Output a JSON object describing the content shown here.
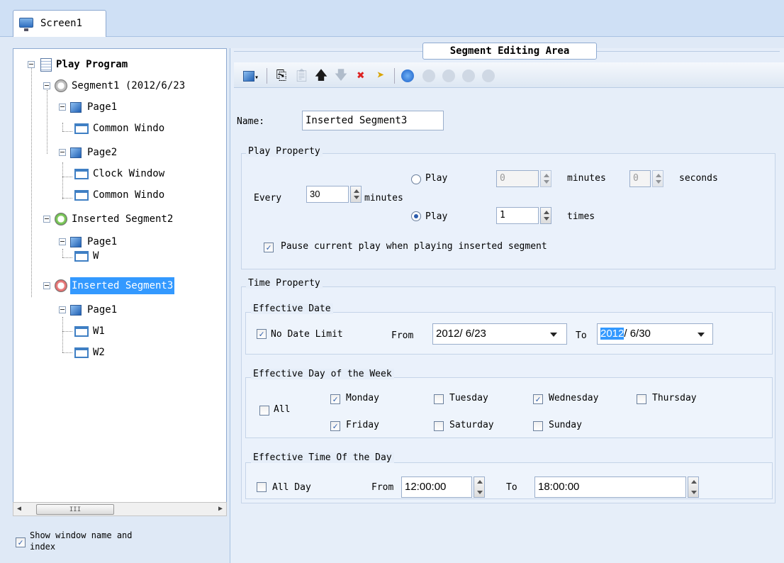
{
  "tabs": {
    "screen_label": "Screen1"
  },
  "tree": {
    "root": "Play Program",
    "segment1": "Segment1 (2012/6/23",
    "seg1_page1": "Page1",
    "seg1_page1_win": "Common Windo",
    "seg1_page2": "Page2",
    "seg1_page2_win1": "Clock Window",
    "seg1_page2_win2": "Common Windo",
    "segment2": "Inserted Segment2",
    "seg2_page1": "Page1",
    "seg2_page1_win": "W",
    "segment3": "Inserted Segment3",
    "seg3_page1": "Page1",
    "seg3_page1_win1": "W1",
    "seg3_page1_win2": "W2"
  },
  "scroll_thumb_label": "III",
  "show_window_label_line1": "Show window name and",
  "show_window_label_line2": "index",
  "area_title": "Segment Editing Area",
  "toolbar_icons": [
    "page-dropdown",
    "copy",
    "paste",
    "move-up",
    "move-down",
    "delete",
    "clear",
    "play",
    "stop-1",
    "stop-2",
    "pause",
    "stop"
  ],
  "name": {
    "label": "Name:",
    "value": "Inserted Segment3"
  },
  "play_property": {
    "title": "Play Property",
    "every_label": "Every",
    "every_value": "30",
    "minutes_label": "minutes",
    "play_label": "Play",
    "play_minutes_value": "0",
    "minutes_label2": "minutes",
    "play_seconds_value": "0",
    "seconds_label": "seconds",
    "play_times_value": "1",
    "times_label": "times",
    "pause_label": "Pause current play when playing inserted segment"
  },
  "time_property": {
    "title": "Time Property",
    "effective_date": {
      "title": "Effective Date",
      "no_date_limit": "No Date Limit",
      "from_label": "From",
      "from_value": "2012/ 6/23",
      "to_label": "To",
      "to_year": "2012",
      "to_rest": "/ 6/30"
    },
    "weekdays": {
      "title": "Effective Day of the Week",
      "all": "All",
      "monday": "Monday",
      "tuesday": "Tuesday",
      "wednesday": "Wednesday",
      "thursday": "Thursday",
      "friday": "Friday",
      "saturday": "Saturday",
      "sunday": "Sunday"
    },
    "time_of_day": {
      "title": "Effective Time Of the Day",
      "all_day": "All Day",
      "from_label": "From",
      "from_value": "12:00:00",
      "to_label": "To",
      "to_value": "18:00:00"
    }
  },
  "colors": {
    "selection": "#3399ff",
    "panel": "#e6eef9",
    "accent": "#2b5cac"
  }
}
